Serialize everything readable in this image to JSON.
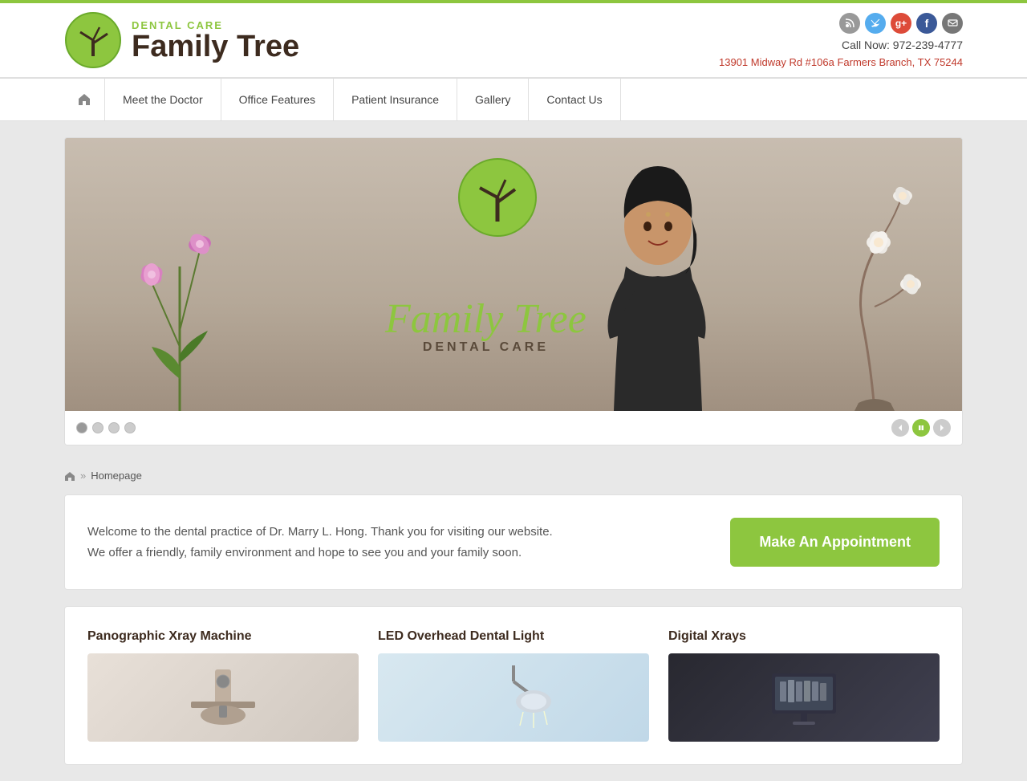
{
  "topBar": {},
  "header": {
    "logoDentalCare": "DENTAL CARE",
    "logoFamilyTree": "Family Tree",
    "phone": "Call Now: 972-239-4777",
    "address": "13901 Midway Rd #106a Farmers Branch, TX 75244",
    "socialIcons": [
      {
        "name": "rss",
        "label": "RSS"
      },
      {
        "name": "twitter",
        "label": "T"
      },
      {
        "name": "google",
        "label": "G"
      },
      {
        "name": "facebook",
        "label": "f"
      },
      {
        "name": "email",
        "label": "@"
      }
    ]
  },
  "nav": {
    "homeLabel": "⌂",
    "items": [
      {
        "label": "Meet the Doctor",
        "id": "meet-doctor"
      },
      {
        "label": "Office Features",
        "id": "office-features"
      },
      {
        "label": "Patient Insurance",
        "id": "patient-insurance"
      },
      {
        "label": "Gallery",
        "id": "gallery"
      },
      {
        "label": "Contact Us",
        "id": "contact-us"
      }
    ]
  },
  "slider": {
    "dots": [
      {
        "active": true
      },
      {
        "active": false
      },
      {
        "active": false
      },
      {
        "active": false
      }
    ],
    "imageText": {
      "big": "Family Tree",
      "small": "DENTAL CARE"
    }
  },
  "breadcrumb": {
    "homeLabel": "⌂",
    "separator": "»",
    "current": "Homepage"
  },
  "welcome": {
    "text": "Welcome to the dental practice of Dr. Marry L. Hong. Thank you for visiting our website. We offer a friendly, family environment and hope to see you and your family soon.",
    "appointmentBtn": "Make An Appointment"
  },
  "features": {
    "items": [
      {
        "title": "Panographic Xray Machine",
        "imgType": "xray"
      },
      {
        "title": "LED Overhead Dental Light",
        "imgType": "light"
      },
      {
        "title": "Digital Xrays",
        "imgType": "digital"
      }
    ]
  }
}
